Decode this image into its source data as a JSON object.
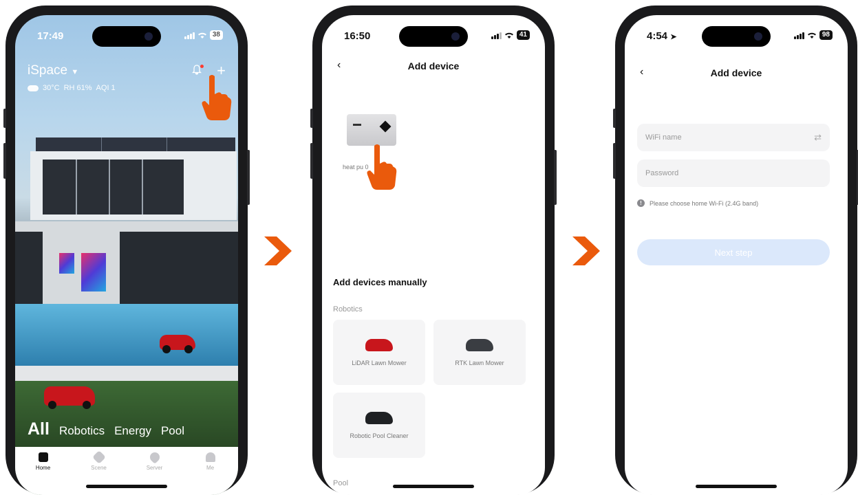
{
  "phones": [
    {
      "time": "17:49",
      "battery": "38",
      "home_label": "iSpace",
      "weather": {
        "temp": "30°C",
        "rh": "RH 61%",
        "aqi": "AQI 1"
      },
      "categories": [
        "All",
        "Robotics",
        "Energy",
        "Pool"
      ],
      "tabs": [
        "Home",
        "Scene",
        "Server",
        "Me"
      ]
    },
    {
      "time": "16:50",
      "battery": "41",
      "title": "Add device",
      "discovered_device_label": "heat pu          0",
      "section_title": "Add devices manually",
      "section_subtitle": "Robotics",
      "cards": [
        "LiDAR Lawn Mower",
        "RTK Lawn Mower",
        "Robotic Pool Cleaner"
      ],
      "next_section": "Pool"
    },
    {
      "time": "4:54",
      "battery": "98",
      "title": "Add device",
      "wifi_placeholder": "WiFi name",
      "password_placeholder": "Password",
      "hint": "Please choose home Wi-Fi (2.4G band)",
      "next_label": "Next step"
    }
  ],
  "colors": {
    "accent": "#ea5a0c",
    "button_disabled": "#dbe8fb"
  },
  "icons": [
    "back-icon",
    "bell-icon",
    "plus-icon",
    "swap-icon",
    "info-icon",
    "location-arrow-icon",
    "pointing-hand-icon",
    "chevron-right-arrow-icon"
  ]
}
